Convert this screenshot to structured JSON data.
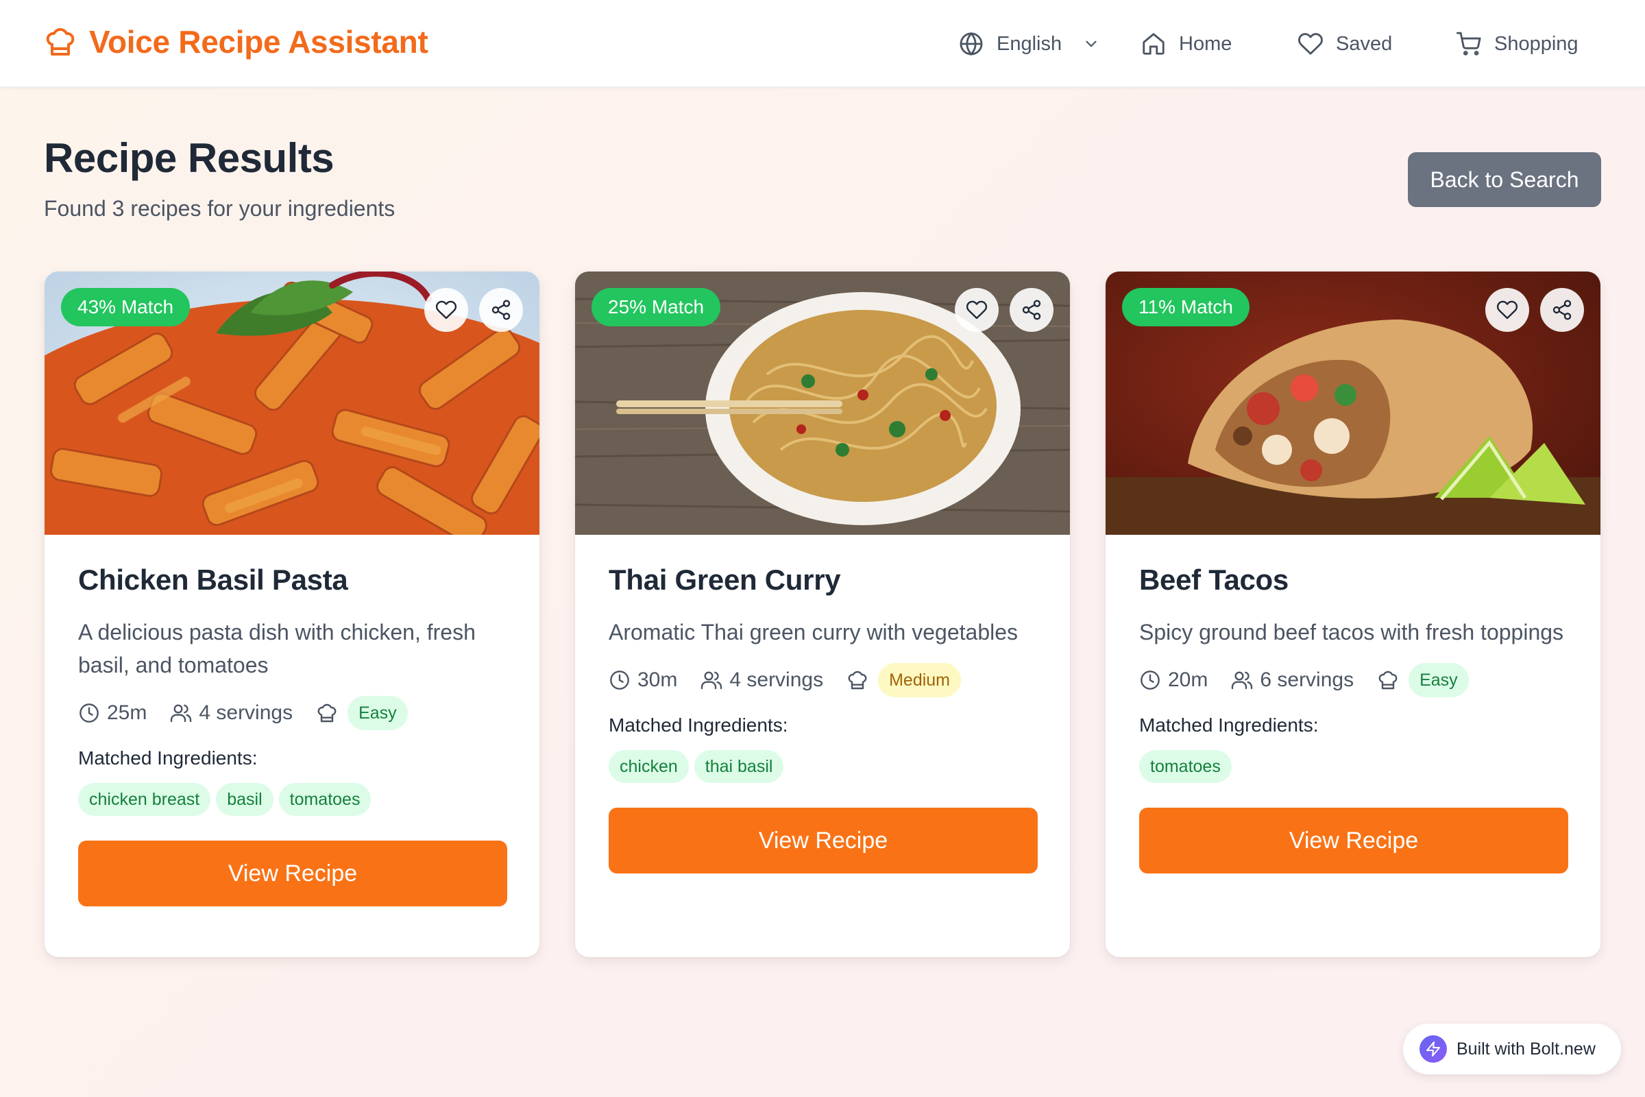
{
  "app": {
    "title": "Voice Recipe Assistant"
  },
  "nav": {
    "language": "English",
    "home": "Home",
    "saved": "Saved",
    "shopping": "Shopping"
  },
  "results": {
    "title": "Recipe Results",
    "subtitle": "Found 3 recipes for your ingredients",
    "back_label": "Back to Search"
  },
  "labels": {
    "matched_ingredients": "Matched Ingredients:",
    "view_recipe": "View Recipe"
  },
  "recipes": [
    {
      "match": "43% Match",
      "title": "Chicken Basil Pasta",
      "description": "A delicious pasta dish with chicken, fresh basil, and tomatoes",
      "time": "25m",
      "servings": "4 servings",
      "difficulty": "Easy",
      "ingredients": [
        "chicken breast",
        "basil",
        "tomatoes"
      ]
    },
    {
      "match": "25% Match",
      "title": "Thai Green Curry",
      "description": "Aromatic Thai green curry with vegetables",
      "time": "30m",
      "servings": "4 servings",
      "difficulty": "Medium",
      "ingredients": [
        "chicken",
        "thai basil"
      ]
    },
    {
      "match": "11% Match",
      "title": "Beef Tacos",
      "description": "Spicy ground beef tacos with fresh toppings",
      "time": "20m",
      "servings": "6 servings",
      "difficulty": "Easy",
      "ingredients": [
        "tomatoes"
      ]
    }
  ],
  "footer_badge": "Built with Bolt.new",
  "colors": {
    "brand": "#f26a1b",
    "primary_button": "#f97316",
    "match_badge": "#22c55e",
    "secondary_button": "#6b7280",
    "tag_bg": "#dcfce7",
    "tag_text": "#15803d"
  },
  "icons": {
    "brand": "chef-hat-icon",
    "language": "globe-icon",
    "home": "home-icon",
    "saved": "heart-icon",
    "shopping": "cart-icon"
  }
}
